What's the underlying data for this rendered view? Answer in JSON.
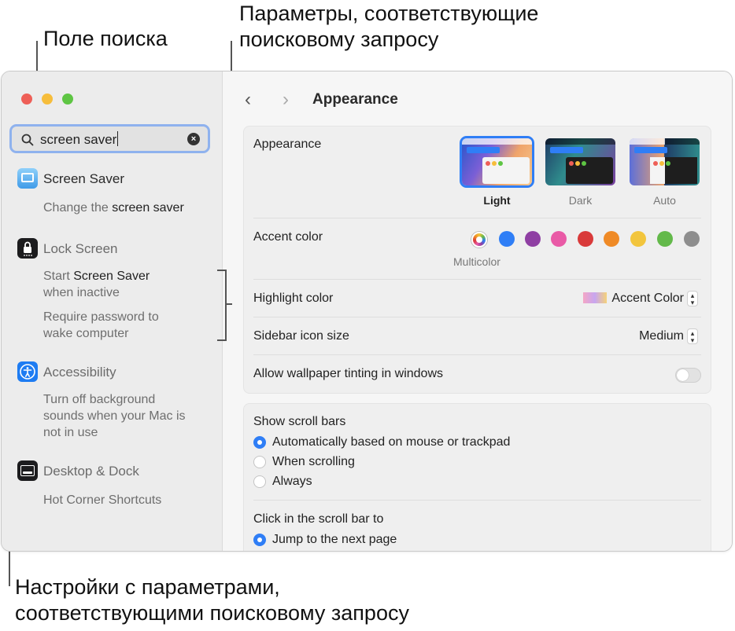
{
  "callouts": {
    "search_field": "Поле поиска",
    "matching_options_line1": "Параметры, соответствующие",
    "matching_options_line2": "поисковому запросу",
    "matching_settings_line1": "Настройки с параметрами,",
    "matching_settings_line2": "соответствующими поисковому запросу"
  },
  "search": {
    "value": "screen saver"
  },
  "sidebar": {
    "items": [
      {
        "title": "Screen Saver",
        "icon": "screen-saver-icon",
        "color": "#5ab0f0",
        "subs": [
          [
            "Change the ",
            "screen saver",
            ""
          ]
        ]
      },
      {
        "title": "Lock Screen",
        "icon": "lock-icon",
        "color": "#1c1c1e",
        "subs": [
          [
            "Start ",
            "Screen Saver",
            "",
            "when inactive"
          ],
          [
            "Require password to",
            "",
            "",
            "wake computer"
          ]
        ]
      },
      {
        "title": "Accessibility",
        "icon": "accessibility-icon",
        "color": "#1e7cf2",
        "subs": [
          [
            "Turn off background",
            "",
            "",
            "sounds when your Mac is",
            "not in use"
          ]
        ]
      },
      {
        "title": "Desktop & Dock",
        "icon": "dock-icon",
        "color": "#1c1c1e",
        "subs": [
          [
            "Hot Corner Shortcuts",
            "",
            ""
          ]
        ]
      }
    ],
    "screen_saver_title": "Screen Saver",
    "screen_saver_sub_pre": "Change the ",
    "screen_saver_sub_hit": "screen saver",
    "lock_title": "Lock Screen",
    "lock_sub1_pre": "Start ",
    "lock_sub1_hit": "Screen Saver",
    "lock_sub1_line2": "when inactive",
    "lock_sub2_line1": "Require password to",
    "lock_sub2_line2": "wake computer",
    "access_title": "Accessibility",
    "access_sub_line1": "Turn off background",
    "access_sub_line2": "sounds when your Mac is",
    "access_sub_line3": "not in use",
    "dock_title": "Desktop & Dock",
    "dock_sub": "Hot Corner Shortcuts"
  },
  "toolbar": {
    "back": "‹",
    "forward": "›",
    "title": "Appearance"
  },
  "appearance": {
    "label": "Appearance",
    "options": [
      "Light",
      "Dark",
      "Auto"
    ],
    "selected": "Light",
    "accent_label": "Accent color",
    "accent_selected_name": "Multicolor",
    "accent_colors": [
      "#2f7ef6",
      "#8f3fa3",
      "#e95aa6",
      "#d93a3a",
      "#ef8a26",
      "#f2c53d",
      "#63b94a",
      "#8e8e8e"
    ],
    "highlight_label": "Highlight color",
    "highlight_value": "Accent Color",
    "icon_size_label": "Sidebar icon size",
    "icon_size_value": "Medium",
    "tinting_label": "Allow wallpaper tinting in windows",
    "tinting_on": false
  },
  "scroll": {
    "label": "Show scroll bars",
    "options": [
      "Automatically based on mouse or trackpad",
      "When scrolling",
      "Always"
    ],
    "click_label": "Click in the scroll bar to",
    "click_option": "Jump to the next page"
  }
}
